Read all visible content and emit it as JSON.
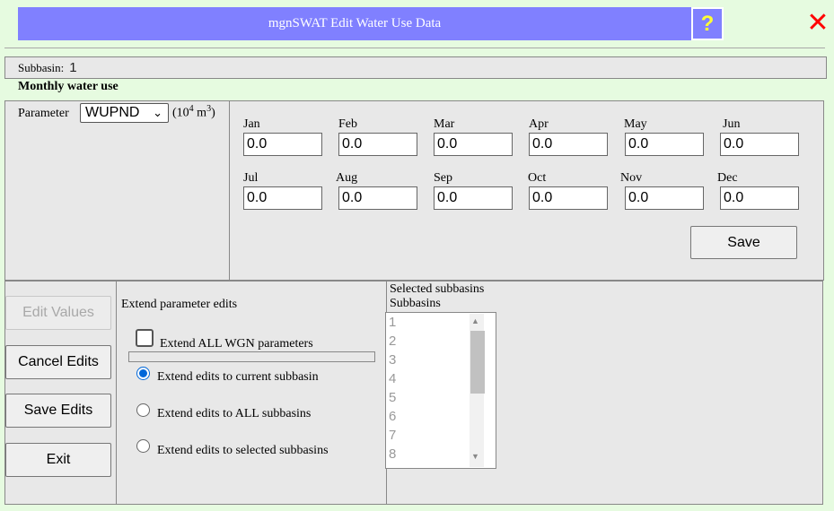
{
  "window": {
    "title": "mgnSWAT Edit Water Use Data",
    "help_icon": "?",
    "close_icon": "✕"
  },
  "subbasin": {
    "label": "Subbasin:",
    "value": "1"
  },
  "section_title": "Monthly water use",
  "parameter": {
    "label": "Parameter",
    "selected": "WUPND",
    "unit_prefix": "(10",
    "unit_exp1": "4",
    "unit_mid": " m",
    "unit_exp2": "3",
    "unit_suffix": ")"
  },
  "months": [
    {
      "label": "Jan",
      "value": "0.0"
    },
    {
      "label": "Feb",
      "value": "0.0"
    },
    {
      "label": "Mar",
      "value": "0.0"
    },
    {
      "label": "Apr",
      "value": "0.0"
    },
    {
      "label": "May",
      "value": "0.0"
    },
    {
      "label": "Jun",
      "value": "0.0"
    },
    {
      "label": "Jul",
      "value": "0.0"
    },
    {
      "label": "Aug",
      "value": "0.0"
    },
    {
      "label": "Sep",
      "value": "0.0"
    },
    {
      "label": "Oct",
      "value": "0.0"
    },
    {
      "label": "Nov",
      "value": "0.0"
    },
    {
      "label": "Dec",
      "value": "0.0"
    }
  ],
  "buttons": {
    "save": "Save",
    "edit_values": "Edit Values",
    "cancel_edits": "Cancel Edits",
    "save_edits": "Save Edits",
    "exit": "Exit"
  },
  "extend": {
    "title": "Extend parameter edits",
    "checkbox_label": "Extend ALL WGN parameters",
    "checkbox_checked": false,
    "radios": [
      {
        "label": "Extend edits to current subbasin",
        "checked": true
      },
      {
        "label": "Extend edits to ALL subbasins",
        "checked": false
      },
      {
        "label": "Extend edits to selected subbasins",
        "checked": false
      }
    ]
  },
  "selected_subbasins": {
    "title": "Selected subbasins",
    "list_header": "Subbasins",
    "items": [
      "1",
      "2",
      "3",
      "4",
      "5",
      "6",
      "7",
      "8"
    ]
  }
}
